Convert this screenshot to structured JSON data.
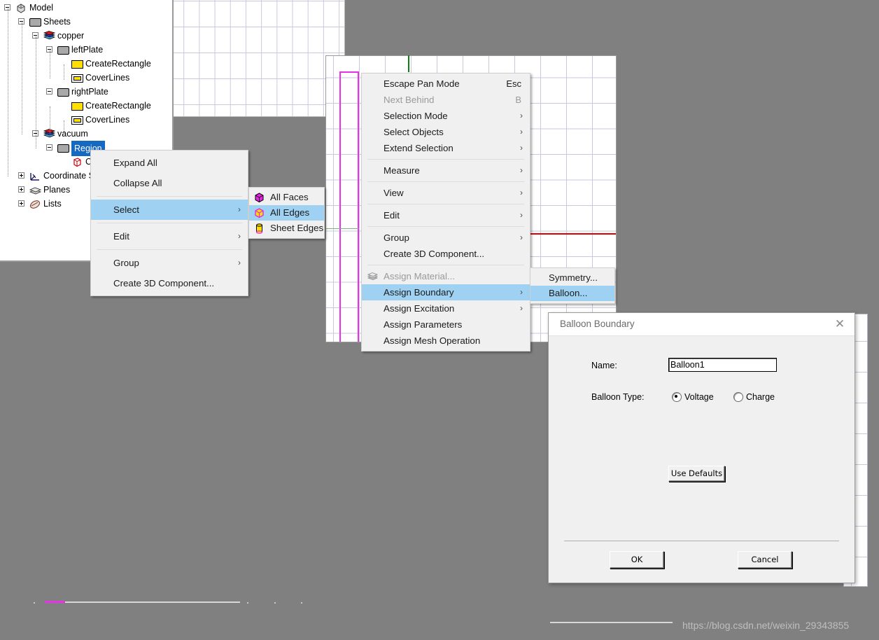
{
  "app": {
    "watermark": "https://blog.csdn.net/weixin_29343855"
  },
  "tree": {
    "name": "Model Project Tree",
    "items": [
      {
        "label": "Model",
        "icon": "model-icon",
        "indent": 0,
        "toggle": "expanded"
      },
      {
        "label": "Sheets",
        "icon": "sheet-icon",
        "indent": 1,
        "toggle": "expanded"
      },
      {
        "label": "copper",
        "icon": "stack-icon",
        "indent": 2,
        "toggle": "expanded"
      },
      {
        "label": "leftPlate",
        "icon": "sheet-icon",
        "indent": 3,
        "toggle": "expanded"
      },
      {
        "label": "CreateRectangle",
        "icon": "rectangle-icon",
        "indent": 4,
        "toggle": "none"
      },
      {
        "label": "CoverLines",
        "icon": "coverlines-icon",
        "indent": 4,
        "toggle": "none"
      },
      {
        "label": "rightPlate",
        "icon": "sheet-icon",
        "indent": 3,
        "toggle": "expanded"
      },
      {
        "label": "CreateRectangle",
        "icon": "rectangle-icon",
        "indent": 4,
        "toggle": "none"
      },
      {
        "label": "CoverLines",
        "icon": "coverlines-icon",
        "indent": 4,
        "toggle": "none"
      },
      {
        "label": "vacuum",
        "icon": "stack-icon",
        "indent": 2,
        "toggle": "expanded"
      },
      {
        "label": "Region",
        "icon": "sheet-icon",
        "indent": 3,
        "toggle": "expanded",
        "selected": true
      },
      {
        "label": "C",
        "icon": "box-icon",
        "indent": 4,
        "toggle": "none"
      },
      {
        "label": "Coordinate Sys",
        "icon": "coordinate-icon",
        "indent": 1,
        "toggle": "collapsed"
      },
      {
        "label": "Planes",
        "icon": "planes-icon",
        "indent": 1,
        "toggle": "collapsed"
      },
      {
        "label": "Lists",
        "icon": "lists-icon",
        "indent": 1,
        "toggle": "collapsed"
      }
    ],
    "selection_color": "#1669c1"
  },
  "tree_context_menu": {
    "name": "tree-context-menu",
    "items": [
      {
        "label": "Expand All",
        "submenu": false
      },
      {
        "label": "Collapse All",
        "submenu": false
      },
      {
        "separator": true
      },
      {
        "label": "Select",
        "submenu": true,
        "highlighted": true
      },
      {
        "separator": true
      },
      {
        "label": "Edit",
        "submenu": true
      },
      {
        "separator": true
      },
      {
        "label": "Group",
        "submenu": true
      },
      {
        "label": "Create 3D Component...",
        "submenu": false
      }
    ]
  },
  "select_submenu": {
    "name": "select-submenu",
    "items": [
      {
        "label": "All Faces",
        "icon": "magenta-cube-icon"
      },
      {
        "label": "All Edges",
        "icon": "yellow-cube-icon",
        "highlighted": true
      },
      {
        "label": "Sheet Edges",
        "icon": "yellow-cylinder-icon"
      }
    ]
  },
  "main_context_menu": {
    "name": "viewport-context-menu",
    "items": [
      {
        "label": "Escape Pan Mode",
        "accelerator": "Esc",
        "submenu": false
      },
      {
        "label": "Next Behind",
        "accelerator": "B",
        "submenu": false,
        "disabled": true
      },
      {
        "label": "Selection Mode",
        "submenu": true
      },
      {
        "label": "Select Objects",
        "submenu": true
      },
      {
        "label": "Extend Selection",
        "submenu": true
      },
      {
        "separator": true
      },
      {
        "label": "Measure",
        "submenu": true
      },
      {
        "separator": true
      },
      {
        "label": "View",
        "submenu": true
      },
      {
        "separator": true
      },
      {
        "label": "Edit",
        "submenu": true
      },
      {
        "separator": true
      },
      {
        "label": "Group",
        "submenu": true
      },
      {
        "label": "Create 3D Component...",
        "submenu": false
      },
      {
        "separator": true
      },
      {
        "label": "Assign Material...",
        "submenu": false,
        "disabled": true,
        "icon": "material-stack-icon"
      },
      {
        "label": "Assign Boundary",
        "submenu": true,
        "highlighted": true
      },
      {
        "label": "Assign Excitation",
        "submenu": true
      },
      {
        "label": "Assign Parameters",
        "submenu": false
      },
      {
        "label": "Assign Mesh Operation",
        "submenu": false
      }
    ]
  },
  "boundary_submenu": {
    "name": "assign-boundary-submenu",
    "items": [
      {
        "label": "Symmetry...",
        "highlighted": false
      },
      {
        "label": "Balloon...",
        "highlighted": true
      }
    ]
  },
  "dialog": {
    "title": "Balloon Boundary",
    "close_label": "✕",
    "name_label": "Name:",
    "name_value": "Balloon1",
    "balloon_type_label": "Balloon Type:",
    "radio_voltage": "Voltage",
    "radio_charge": "Charge",
    "selected_type": "Voltage",
    "use_defaults": "Use Defaults",
    "ok": "OK",
    "cancel": "Cancel"
  },
  "colors": {
    "menu_highlight": "#9fd2f2",
    "selection_blue": "#1669c1",
    "geometry_magenta": "#e832e8",
    "geometry_green": "#127d12",
    "geometry_red": "#e00000",
    "desktop_gray": "#808080"
  }
}
